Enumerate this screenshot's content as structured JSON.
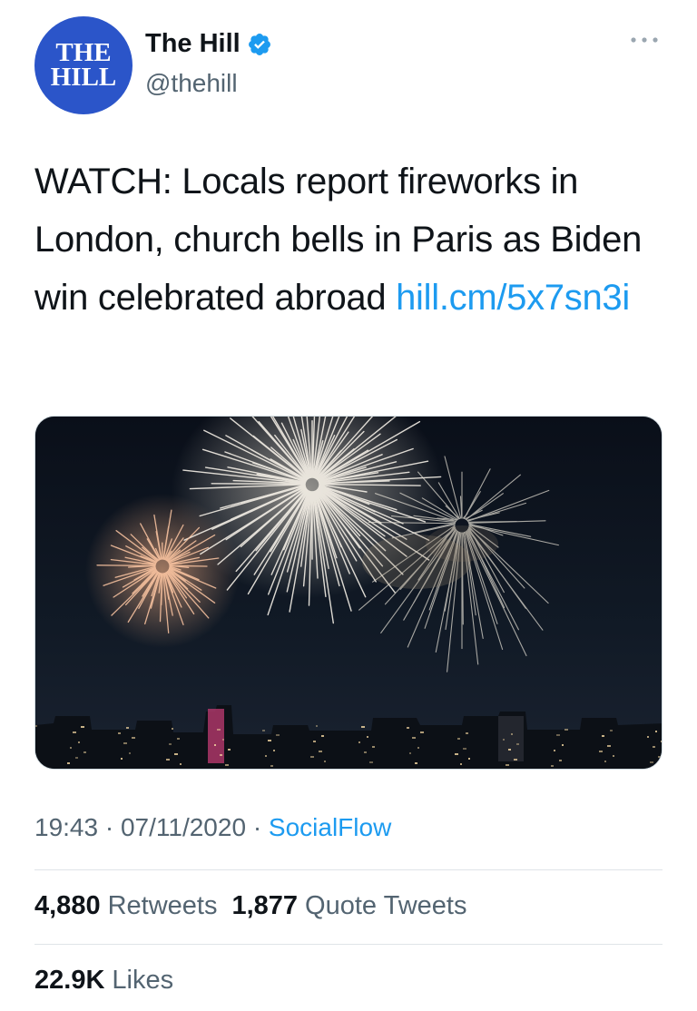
{
  "account": {
    "avatar_line1": "THE",
    "avatar_line2": "HILL",
    "display_name": "The Hill",
    "handle": "@thehill",
    "brand_color": "#2b55c9",
    "verified_icon": "verified-badge-icon"
  },
  "tweet": {
    "text": "WATCH: Locals report fireworks in London, church bells in Paris as Biden win celebrated abroad ",
    "link": "hill.cm/5x7sn3i",
    "link_color": "#1d9bf0"
  },
  "media": {
    "alt": "Fireworks over a city skyline at night"
  },
  "meta": {
    "time": "19:43",
    "separator1": "·",
    "date": "07/11/2020",
    "separator2": "·",
    "source": "SocialFlow"
  },
  "stats": {
    "retweets_count": "4,880",
    "retweets_label": "Retweets",
    "quotes_count": "1,877",
    "quotes_label": "Quote Tweets",
    "likes_count": "22.9K",
    "likes_label": "Likes"
  }
}
